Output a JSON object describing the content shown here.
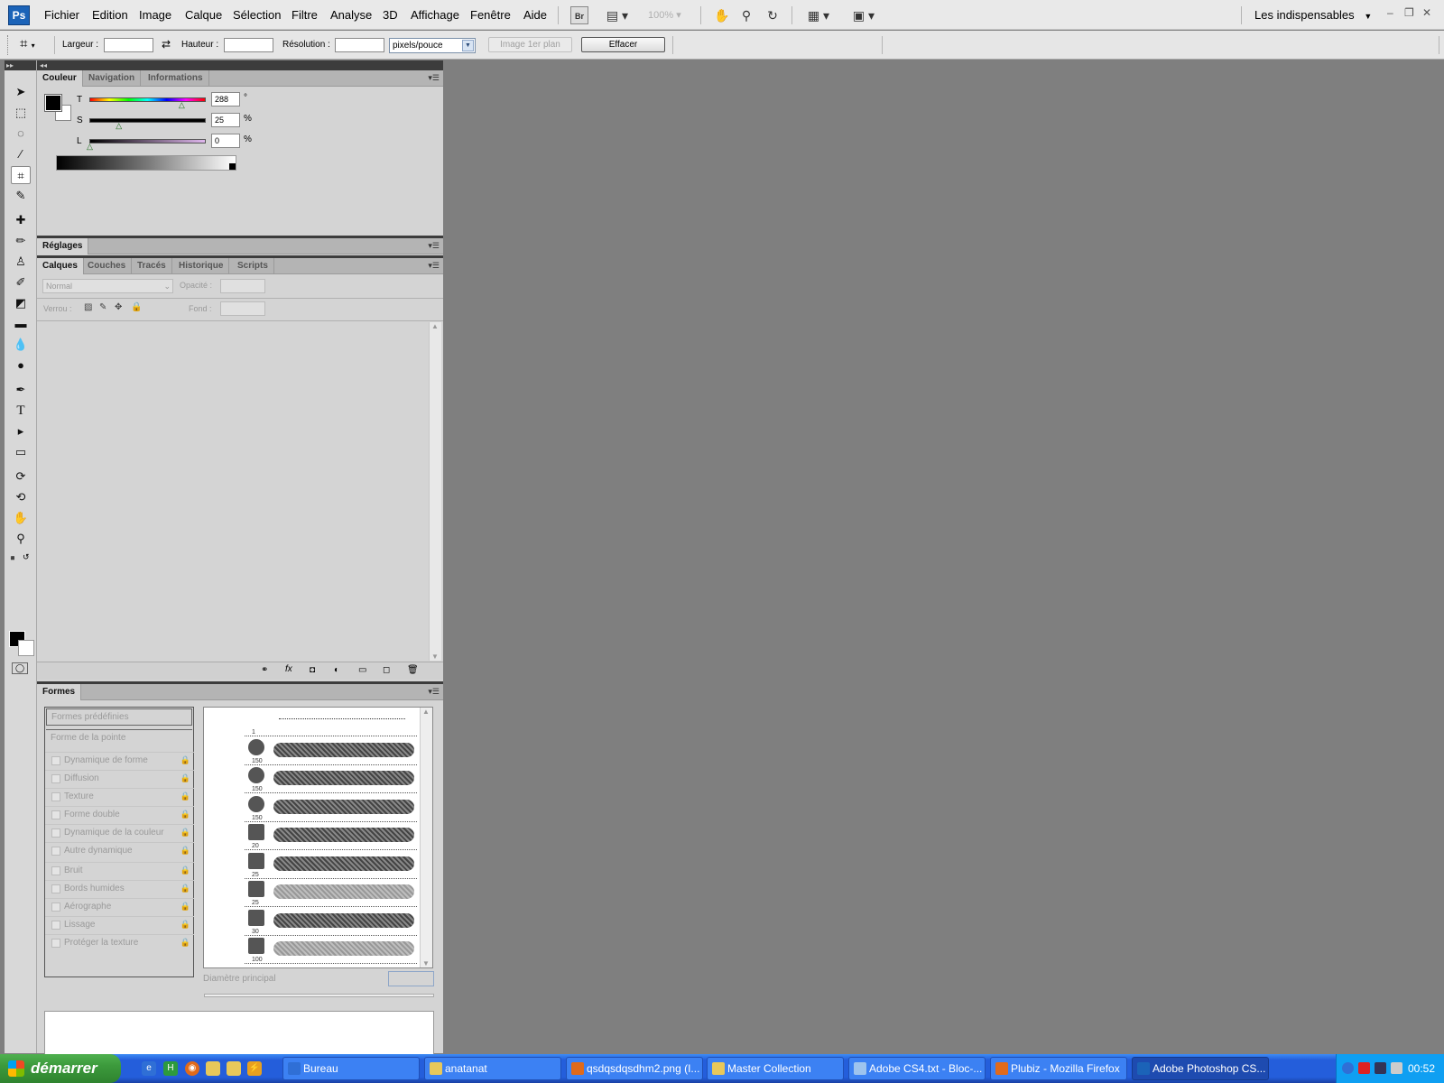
{
  "app": {
    "logo": "Ps"
  },
  "menubar": {
    "items": [
      "Fichier",
      "Edition",
      "Image",
      "Calque",
      "Sélection",
      "Filtre",
      "Analyse",
      "3D",
      "Affichage",
      "Fenêtre",
      "Aide"
    ],
    "bridge_label": "Br",
    "zoom": "100%",
    "workspace": "Les indispensables",
    "workspace_arrow": "▼"
  },
  "options": {
    "width_label": "Largeur :",
    "height_label": "Hauteur :",
    "resolution_label": "Résolution :",
    "units": "pixels/pouce",
    "front_image": "Image 1er plan",
    "clear": "Effacer"
  },
  "color_panel": {
    "tabs": [
      "Couleur",
      "Navigation",
      "Informations"
    ],
    "sliders": [
      {
        "label": "T",
        "value": "288",
        "unit": "°",
        "thumb": 0.79
      },
      {
        "label": "S",
        "value": "25",
        "unit": "%",
        "thumb": 0.25
      },
      {
        "label": "L",
        "value": "0",
        "unit": "%",
        "thumb": 0.0
      }
    ]
  },
  "adjust_panel": {
    "tabs": [
      "Réglages"
    ]
  },
  "layers_panel": {
    "tabs": [
      "Calques",
      "Couches",
      "Tracés",
      "Historique",
      "Scripts"
    ],
    "blend_mode": "Normal",
    "opacity_label": "Opacité :",
    "lock_label": "Verrou :",
    "fill_label": "Fond :"
  },
  "brushes_panel": {
    "tabs": [
      "Formes"
    ],
    "presets": "Formes prédéfinies",
    "tip_shape": "Forme de la pointe",
    "options": [
      {
        "label": "Dynamique de forme"
      },
      {
        "label": "Diffusion"
      },
      {
        "label": "Texture"
      },
      {
        "label": "Forme double"
      },
      {
        "label": "Dynamique de la couleur"
      },
      {
        "label": "Autre dynamique"
      },
      {
        "label": "Bruit"
      },
      {
        "label": "Bords humides"
      },
      {
        "label": "Aérographe"
      },
      {
        "label": "Lissage"
      },
      {
        "label": "Protéger la texture"
      }
    ],
    "brush_sizes": [
      "1",
      "150",
      "150",
      "150",
      "20",
      "25",
      "25",
      "30",
      "100"
    ],
    "diameter_label": "Diamètre principal"
  },
  "taskbar": {
    "start": "démarrer",
    "windows": [
      {
        "label": "Bureau",
        "color": "#2f6fd6"
      },
      {
        "label": "anatanat",
        "color": "#e8c85a"
      },
      {
        "label": "qsdqsdqsdhm2.png (I...",
        "color": "#e06a1a"
      },
      {
        "label": "Master Collection",
        "color": "#e8c85a"
      },
      {
        "label": "Adobe CS4.txt - Bloc-...",
        "color": "#9ec4ee"
      },
      {
        "label": "Plubiz - Mozilla Firefox",
        "color": "#e06a1a"
      },
      {
        "label": "Adobe Photoshop CS...",
        "color": "#1b63b8"
      }
    ],
    "clock": "00:52"
  }
}
